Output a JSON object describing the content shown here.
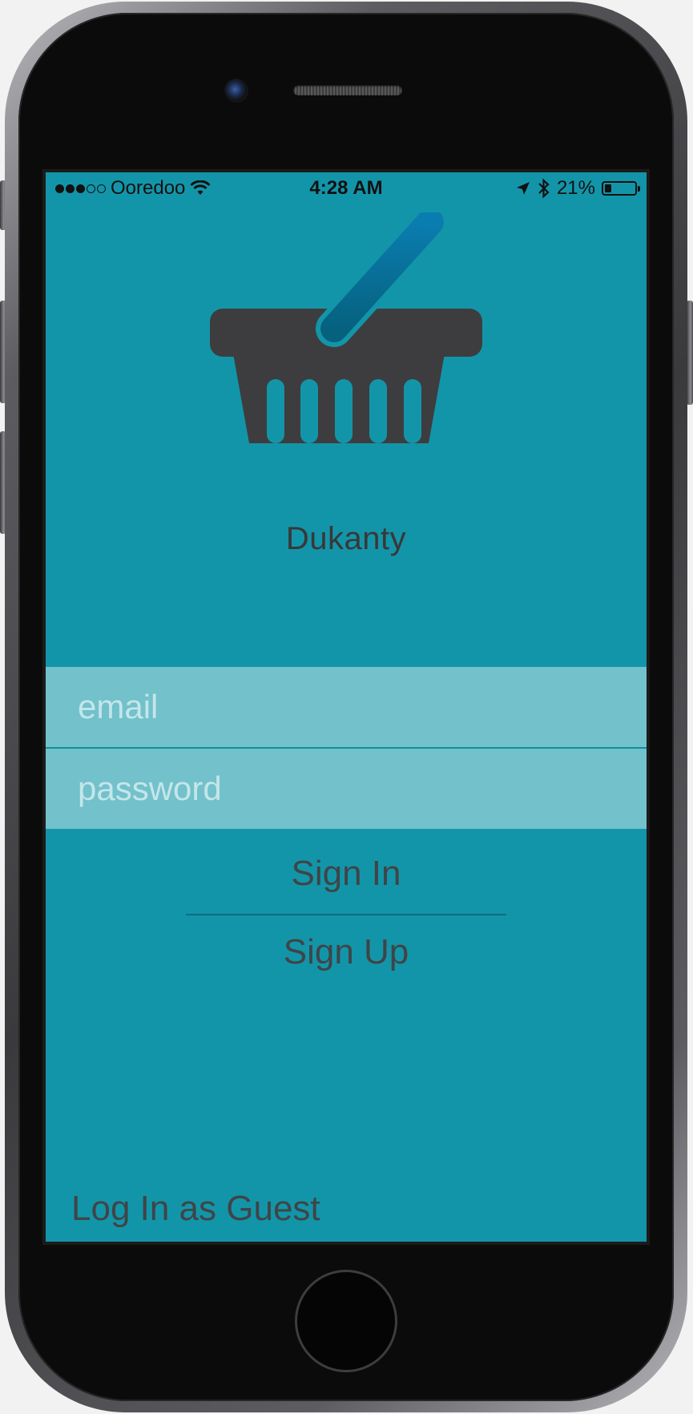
{
  "status_bar": {
    "carrier": "Ooredoo",
    "time": "4:28 AM",
    "battery_text": "21%",
    "battery_level": 0.21,
    "signal_bars_filled": 3,
    "signal_bars_total": 5
  },
  "brand": {
    "name": "Dukanty",
    "logo_icon": "shopping-basket-icon",
    "handle_color": "#0a79a2",
    "basket_color": "#3d3d3f"
  },
  "login_form": {
    "email_placeholder": "email",
    "password_placeholder": "password",
    "email_value": "",
    "password_value": ""
  },
  "actions": {
    "sign_in_label": "Sign In",
    "sign_up_label": "Sign Up",
    "guest_label": "Log In as Guest"
  },
  "colors": {
    "background": "#1395a9",
    "field_background": "#72c1cb",
    "text_dark": "#3f4547"
  }
}
